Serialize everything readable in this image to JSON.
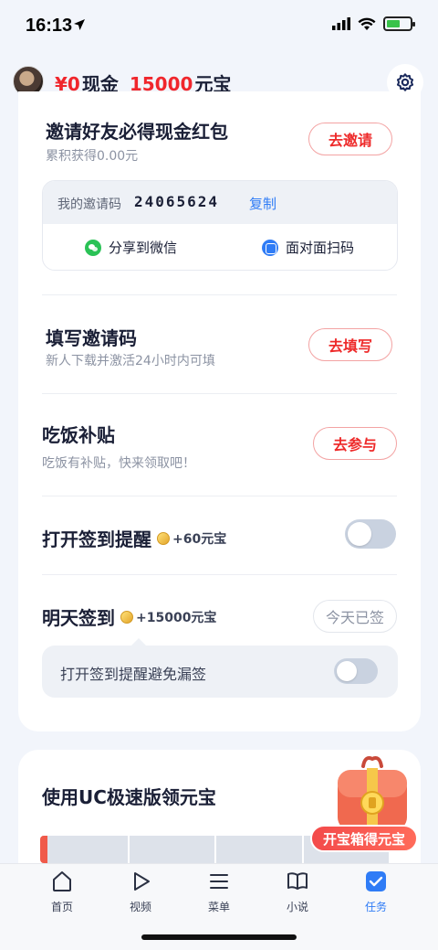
{
  "status_bar": {
    "time": "16:13"
  },
  "header": {
    "cash_amount": "¥0",
    "cash_label": "现金",
    "yuanbao_amount": "15000",
    "yuanbao_label": "元宝"
  },
  "invite": {
    "title": "邀请好友必得现金红包",
    "subtitle": "累积获得0.00元",
    "button": "去邀请",
    "code_label": "我的邀请码",
    "code": "24065624",
    "copy": "复制",
    "share_wechat": "分享到微信",
    "face_scan": "面对面扫码"
  },
  "fill_code": {
    "title": "填写邀请码",
    "subtitle": "新人下载并激活24小时内可填",
    "button": "去填写"
  },
  "meal": {
    "title": "吃饭补贴",
    "subtitle": "吃饭有补贴，快来领取吧！",
    "button": "去参与"
  },
  "checkin_reminder": {
    "title": "打开签到提醒",
    "reward": "+60元宝",
    "enabled": false
  },
  "tomorrow": {
    "title": "明天签到",
    "reward": "+15000元宝",
    "status": "今天已签",
    "reminder_text": "打开签到提醒避免漏签",
    "reminder_enabled": false
  },
  "uc_card": {
    "title": "使用UC极速版领元宝",
    "chest_label": "开宝箱得元宝"
  },
  "tabbar": {
    "items": [
      {
        "label": "首页",
        "icon": "home-icon"
      },
      {
        "label": "视频",
        "icon": "play-icon"
      },
      {
        "label": "菜单",
        "icon": "menu-icon"
      },
      {
        "label": "小说",
        "icon": "book-icon"
      },
      {
        "label": "任务",
        "icon": "task-check-icon",
        "active": true
      }
    ]
  },
  "colors": {
    "accent_red": "#ee2a2a",
    "accent_blue": "#2f7cf6"
  }
}
